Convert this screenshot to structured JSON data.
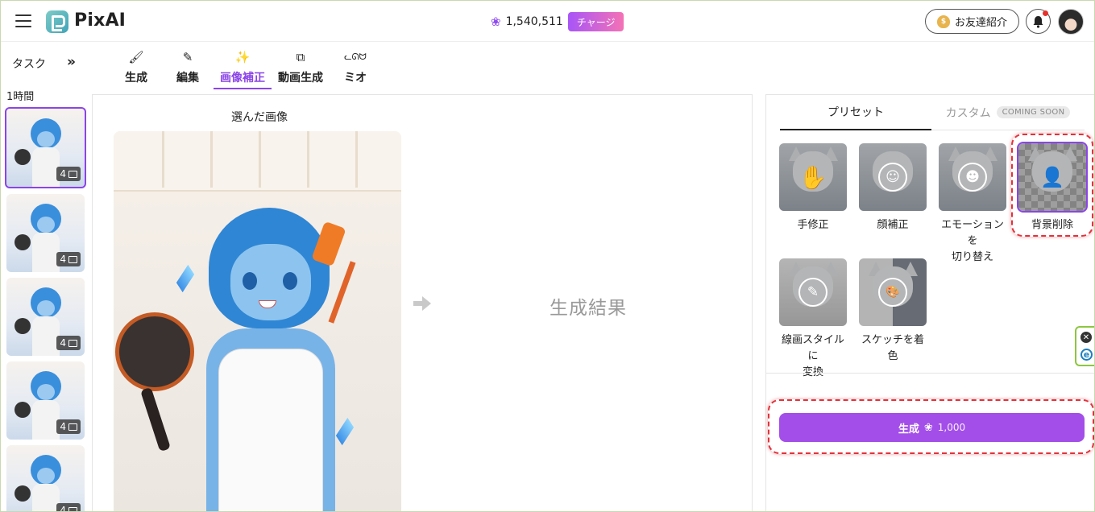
{
  "header": {
    "logo_text": "PixAI",
    "credits": "1,540,511",
    "charge_label": "チャージ",
    "invite_label": "お友達紹介"
  },
  "sidebar": {
    "task_label": "タスク",
    "expand_glyph": "»",
    "time_group_label": "1時間",
    "thumbnails": [
      {
        "count": "4",
        "selected": true
      },
      {
        "count": "4",
        "selected": false
      },
      {
        "count": "4",
        "selected": false
      },
      {
        "count": "4",
        "selected": false
      },
      {
        "count": "4",
        "selected": false
      }
    ]
  },
  "tabs": [
    {
      "label": "生成",
      "icon": "brush-icon",
      "glyph": "🖌"
    },
    {
      "label": "編集",
      "icon": "pencil-icon",
      "glyph": "✎"
    },
    {
      "label": "画像補正",
      "icon": "magic-wand-icon",
      "glyph": "✨",
      "active": true
    },
    {
      "label": "動画生成",
      "icon": "video-plus-icon",
      "glyph": "⧉"
    },
    {
      "label": "ミオ",
      "icon": "cat-face-icon",
      "glyph": "ᓚᘏᗢ"
    }
  ],
  "main": {
    "selected_title": "選んだ画像",
    "result_label": "生成結果"
  },
  "right_panel": {
    "tab_preset": "プリセット",
    "tab_custom": "カスタム",
    "coming_soon": "COMING SOON",
    "presets": [
      {
        "label": "手修正",
        "icon": "hand-icon",
        "glyph": "✋"
      },
      {
        "label": "顔補正",
        "icon": "smiley-icon",
        "glyph": "☺"
      },
      {
        "label": "エモーションを切り替え",
        "label_line1": "エモーションを",
        "label_line2": "切り替え",
        "icon": "smiley-swap-icon",
        "glyph": "☻"
      },
      {
        "label": "背景削除",
        "icon": "person-remove-bg-icon",
        "glyph": "👤",
        "selected": true
      },
      {
        "label": "線画スタイルに変換",
        "label_line1": "線画スタイルに",
        "label_line2": "変換",
        "icon": "pen-line-icon",
        "glyph": "✎"
      },
      {
        "label": "スケッチを着色",
        "icon": "palette-icon",
        "glyph": "🎨"
      }
    ],
    "generate_label": "生成",
    "generate_cost": "1,000"
  },
  "colors": {
    "accent": "#8b44e8",
    "generate_button": "#a34ee9",
    "annotation_red": "#e2323b"
  }
}
